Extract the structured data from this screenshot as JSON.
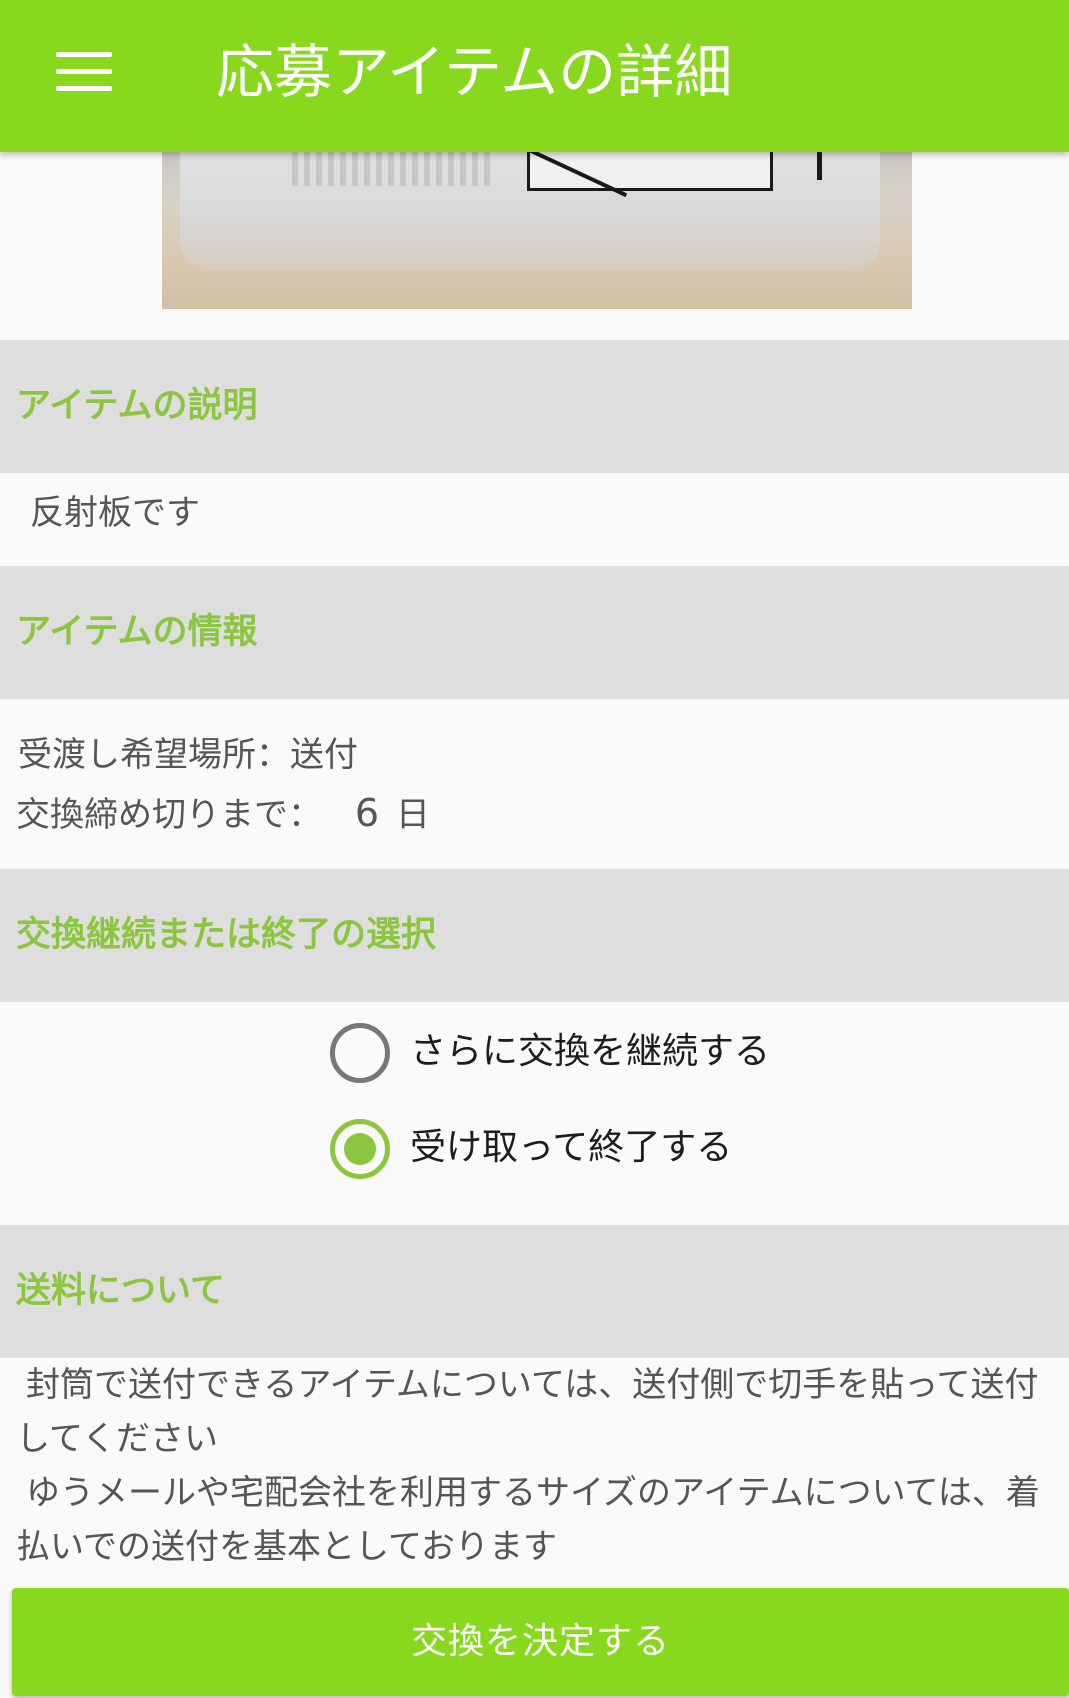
{
  "app_bar": {
    "title": "応募アイテムの詳細",
    "menu_icon": "hamburger-menu-icon",
    "color": "#88d81e"
  },
  "item_photo": {
    "description_icon": "item-photo"
  },
  "sections": {
    "description": {
      "header": "アイテムの説明",
      "text": "反射板です"
    },
    "info": {
      "header": "アイテムの情報",
      "location_line": "受渡し希望場所：送付",
      "deadline_label": "交換締め切りまで：",
      "deadline_value": "6",
      "deadline_unit": "日"
    },
    "choice": {
      "header": "交換継続または終了の選択",
      "options": [
        {
          "label": "さらに交換を継続する",
          "checked": false
        },
        {
          "label": "受け取って終了する",
          "checked": true
        }
      ]
    },
    "shipping": {
      "header": "送料について",
      "paragraph1": "封筒で送付できるアイテムについては、送付側で切手を貼って送付してください",
      "paragraph2": "ゆうメールや宅配会社を利用するサイズのアイテムについては、着払いでの送付を基本としております"
    }
  },
  "confirm_button": {
    "label": "交換を決定する"
  },
  "colors": {
    "accent": "#88d81e",
    "header_text": "#8cc63f",
    "section_bg": "#dedede"
  }
}
